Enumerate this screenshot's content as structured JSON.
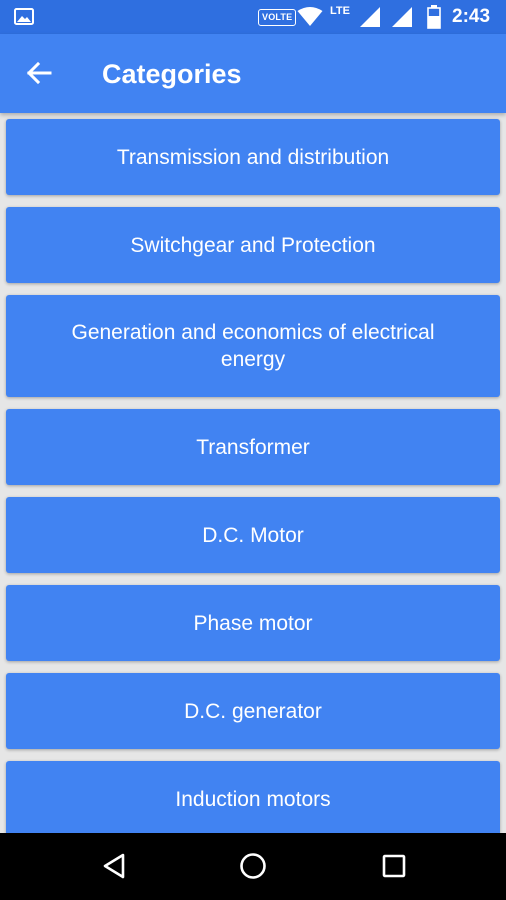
{
  "status_bar": {
    "volte_label": "VOLTE",
    "network_label": "LTE",
    "clock": "2:43",
    "icons": [
      "gallery-icon",
      "wifi-icon",
      "signal-icon",
      "signal-icon",
      "battery-icon"
    ]
  },
  "app_bar": {
    "title": "Categories",
    "back_icon": "arrow-left-icon"
  },
  "categories": [
    {
      "label": "Transmission and distribution"
    },
    {
      "label": "Switchgear and Protection"
    },
    {
      "label": "Generation and economics of electrical energy"
    },
    {
      "label": "Transformer"
    },
    {
      "label": "D.C. Motor"
    },
    {
      "label": "Phase motor"
    },
    {
      "label": "D.C. generator"
    },
    {
      "label": "Induction motors"
    }
  ],
  "nav_bar": {
    "icons": [
      "back-triangle-icon",
      "home-circle-icon",
      "recents-square-icon"
    ]
  },
  "colors": {
    "status_bar": "#2f6fe0",
    "primary": "#4183f2",
    "background": "#e6e6e6",
    "nav_bar": "#000000",
    "text": "#ffffff"
  }
}
